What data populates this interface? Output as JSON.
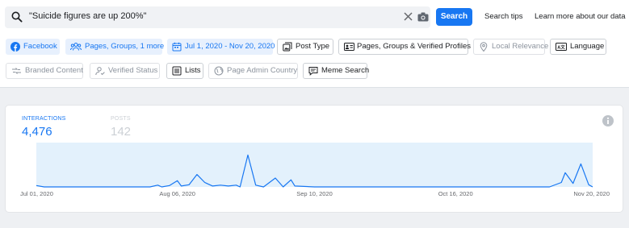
{
  "search": {
    "query": "\"Suicide figures are up 200%\"",
    "button_label": "Search"
  },
  "links": {
    "search_tips": "Search tips",
    "learn_more": "Learn more about our data"
  },
  "filters_row1": [
    {
      "label": "Facebook",
      "icon": "facebook-icon",
      "state": "active"
    },
    {
      "label": "Pages, Groups, 1 more",
      "icon": "groups-icon",
      "state": "active"
    },
    {
      "label": "Jul 1, 2020 - Nov 20, 2020",
      "icon": "calendar-icon",
      "state": "active"
    },
    {
      "label": "Post Type",
      "icon": "post-type-icon",
      "state": "default"
    },
    {
      "label": "Pages, Groups & Verified Profiles",
      "icon": "profiles-icon",
      "state": "default"
    },
    {
      "label": "Local Relevance",
      "icon": "location-pin-icon",
      "state": "disabled"
    },
    {
      "label": "Language",
      "icon": "language-icon",
      "state": "default"
    }
  ],
  "filters_row2": [
    {
      "label": "Branded Content",
      "icon": "branded-content-icon",
      "state": "disabled"
    },
    {
      "label": "Verified Status",
      "icon": "verified-user-icon",
      "state": "disabled"
    },
    {
      "label": "Lists",
      "icon": "list-icon",
      "state": "default"
    },
    {
      "label": "Page Admin Country",
      "icon": "globe-icon",
      "state": "disabled"
    },
    {
      "label": "Meme Search",
      "icon": "meme-icon",
      "state": "default"
    }
  ],
  "metrics": {
    "interactions": {
      "label": "INTERACTIONS",
      "value": "4,476",
      "color": "#1877f2"
    },
    "posts": {
      "label": "POSTS",
      "value": "142",
      "color": "#ccd0d5"
    }
  },
  "colors": {
    "accent": "#1877f2",
    "chart_fill": "#e3f1fc",
    "chart_line": "#1877f2"
  },
  "chart_data": {
    "type": "line",
    "title": "",
    "xlabel": "",
    "ylabel": "",
    "x_tick_labels": [
      "Jul 01, 2020",
      "Aug 06, 2020",
      "Sep 10, 2020",
      "Oct 16, 2020",
      "Nov 20, 2020"
    ],
    "xlim": [
      "2020-07-01",
      "2020-11-20"
    ],
    "ylim": [
      0,
      100
    ],
    "grid": false,
    "series": [
      {
        "values": [
          [
            "2020-07-01",
            3
          ],
          [
            "2020-07-03",
            0
          ],
          [
            "2020-07-30",
            0
          ],
          [
            "2020-08-01",
            4
          ],
          [
            "2020-08-02",
            0
          ],
          [
            "2020-08-04",
            3
          ],
          [
            "2020-08-06",
            14
          ],
          [
            "2020-08-07",
            2
          ],
          [
            "2020-08-09",
            5
          ],
          [
            "2020-08-11",
            28
          ],
          [
            "2020-08-13",
            10
          ],
          [
            "2020-08-15",
            2
          ],
          [
            "2020-08-17",
            4
          ],
          [
            "2020-08-19",
            2
          ],
          [
            "2020-08-21",
            4
          ],
          [
            "2020-08-22",
            0
          ],
          [
            "2020-08-24",
            72
          ],
          [
            "2020-08-26",
            4
          ],
          [
            "2020-08-28",
            0
          ],
          [
            "2020-08-31",
            20
          ],
          [
            "2020-09-02",
            0
          ],
          [
            "2020-09-04",
            16
          ],
          [
            "2020-09-05",
            2
          ],
          [
            "2020-09-10",
            0
          ],
          [
            "2020-11-09",
            0
          ],
          [
            "2020-11-12",
            10
          ],
          [
            "2020-11-13",
            32
          ],
          [
            "2020-11-15",
            8
          ],
          [
            "2020-11-17",
            52
          ],
          [
            "2020-11-19",
            5
          ],
          [
            "2020-11-20",
            0
          ]
        ]
      }
    ]
  }
}
